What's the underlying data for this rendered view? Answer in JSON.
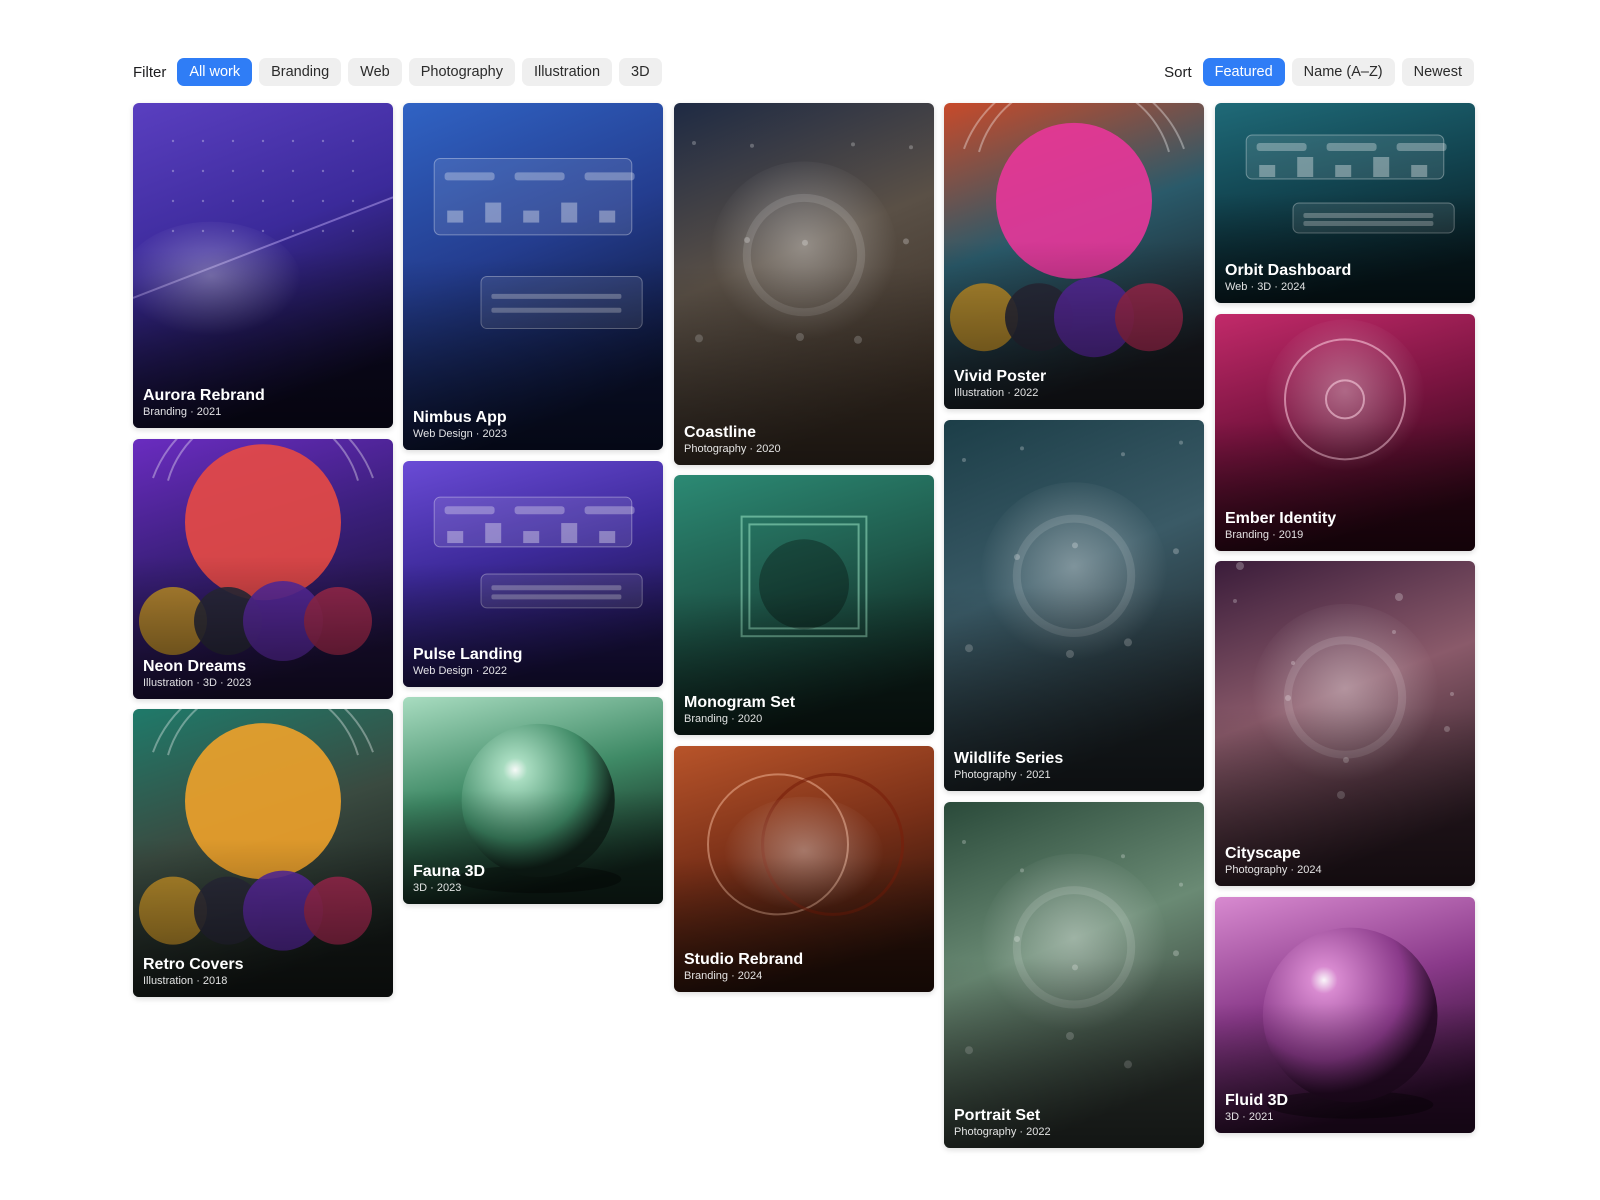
{
  "filter": {
    "label": "Filter",
    "chips": [
      "All work",
      "Branding",
      "Web",
      "Photography",
      "Illustration",
      "3D"
    ],
    "active": "All work"
  },
  "sort": {
    "label": "Sort",
    "chips": [
      "Featured",
      "Name (A–Z)",
      "Newest"
    ],
    "active": "Featured"
  },
  "colors": {
    "accent": "#2f7df6",
    "chip": "#efefef"
  },
  "cards": [
    {
      "title": "Aurora Rebrand",
      "meta": "Branding · 2021",
      "art": "dots-line",
      "bg": [
        "#5a3fc0",
        "#3b2a9a",
        "#0d0a22"
      ]
    },
    {
      "title": "Neon Dreams",
      "meta": "Illustration · 3D · 2023",
      "art": "poster",
      "bg": [
        "#6a2cc0",
        "#3a1f7a",
        "#1b1035"
      ]
    },
    {
      "title": "Retro Covers",
      "meta": "Illustration · 2018",
      "art": "poster",
      "bg": [
        "#1f7a6a",
        "#3a4a40",
        "#151a18"
      ]
    },
    {
      "title": "Nimbus App",
      "meta": "Web Design · 2023",
      "art": "dashboard",
      "bg": [
        "#3063c4",
        "#243d8f",
        "#0b1230"
      ]
    },
    {
      "title": "Pulse Landing",
      "meta": "Web Design · 2022",
      "art": "dashboard",
      "bg": [
        "#6a4bd6",
        "#3d2a9a",
        "#1a1245"
      ]
    },
    {
      "title": "Fauna 3D",
      "meta": "3D · 2023",
      "art": "sphere",
      "bg": [
        "#a8dcc0",
        "#3f8a66",
        "#12261d"
      ]
    },
    {
      "title": "Coastline",
      "meta": "Photography · 2020",
      "art": "bokeh",
      "bg": [
        "#1e2a44",
        "#5a5046",
        "#3a2e24"
      ]
    },
    {
      "title": "Monogram Set",
      "meta": "Branding · 2020",
      "art": "square",
      "bg": [
        "#2c8a74",
        "#1f5a4c",
        "#0d1e19"
      ]
    },
    {
      "title": "Studio Rebrand",
      "meta": "Branding · 2024",
      "art": "rings",
      "bg": [
        "#b8542a",
        "#7a3018",
        "#2a120a"
      ]
    },
    {
      "title": "Vivid Poster",
      "meta": "Illustration · 2022",
      "art": "poster",
      "bg": [
        "#c84a2a",
        "#2a5a6a",
        "#1a1c22"
      ]
    },
    {
      "title": "Wildlife Series",
      "meta": "Photography · 2021",
      "art": "bokeh",
      "bg": [
        "#1c3e48",
        "#3a5a66",
        "#1c2226"
      ]
    },
    {
      "title": "Portrait Set",
      "meta": "Photography · 2022",
      "art": "bokeh",
      "bg": [
        "#2a4a3a",
        "#6a8a74",
        "#2a302c"
      ]
    },
    {
      "title": "Orbit Dashboard",
      "meta": "Web · 3D · 2024",
      "art": "dashboard",
      "bg": [
        "#1f6a78",
        "#124450",
        "#081c22"
      ]
    },
    {
      "title": "Ember Identity",
      "meta": "Branding · 2019",
      "art": "target",
      "bg": [
        "#c22a6a",
        "#7a1440",
        "#2a0614"
      ]
    },
    {
      "title": "Cityscape",
      "meta": "Photography · 2024",
      "art": "bokeh",
      "bg": [
        "#3a1c3a",
        "#8a5a6a",
        "#2a1a22"
      ]
    },
    {
      "title": "Fluid 3D",
      "meta": "3D · 2021",
      "art": "sphere",
      "bg": [
        "#d88ad0",
        "#8a3a8a",
        "#2a0c2a"
      ]
    }
  ]
}
